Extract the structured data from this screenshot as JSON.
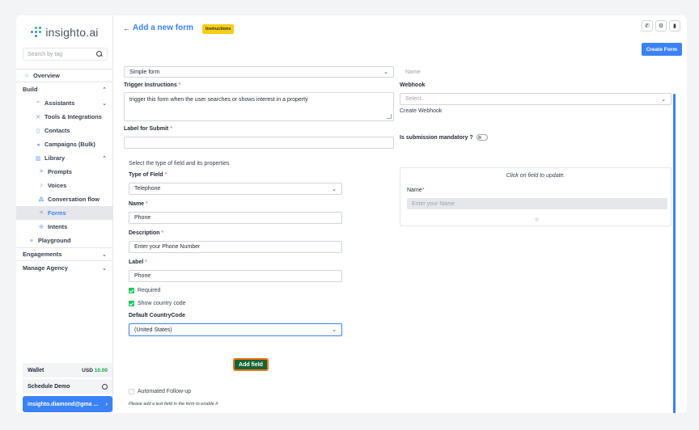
{
  "app": {
    "logo_text": "insighto.ai"
  },
  "sidebar": {
    "search_placeholder": "Search by tag",
    "items": [
      {
        "label": "Overview",
        "icon": "home-icon"
      },
      {
        "label": "Build",
        "icon": ""
      },
      {
        "label": "Assistants",
        "icon": "assistant-icon"
      },
      {
        "label": "Tools & Integrations",
        "icon": "tools-icon"
      },
      {
        "label": "Contacts",
        "icon": "contacts-icon"
      },
      {
        "label": "Campaigns (Bulk)",
        "icon": "megaphone-icon"
      },
      {
        "label": "Library",
        "icon": "library-icon"
      },
      {
        "label": "Prompts",
        "icon": "prompt-icon"
      },
      {
        "label": "Voices",
        "icon": "voice-icon"
      },
      {
        "label": "Conversation flow",
        "icon": "flow-icon"
      },
      {
        "label": "Forms",
        "icon": "forms-icon"
      },
      {
        "label": "Intents",
        "icon": "intents-icon"
      },
      {
        "label": "Playground",
        "icon": "playground-icon"
      },
      {
        "label": "Engagements",
        "icon": ""
      },
      {
        "label": "Manage Agency",
        "icon": ""
      }
    ],
    "wallet_label": "Wallet",
    "wallet_currency": "USD",
    "wallet_amount": "10.00",
    "schedule_label": "Schedule Demo",
    "user_label": "insighto.diamond@gma ..."
  },
  "header": {
    "back": "←",
    "title": "Add a new form",
    "instructions_badge": "Instructions",
    "create_button": "Create Form"
  },
  "form": {
    "form_type_value": "Simple form",
    "name_placeholder": "Name",
    "trigger_label": "Trigger Instructions",
    "trigger_value": "trigger this form when the user searches or shows interest in a property",
    "webhook_label": "Webhook",
    "webhook_placeholder": "Select..",
    "create_webhook": "Create Webhook",
    "submit_label_label": "Label for Submit",
    "submit_label_value": "",
    "mandatory_label": "Is submission mandatory ?",
    "field_section_title": "Select the type of field and its properties",
    "type_label": "Type of Field",
    "type_value": "Telephone",
    "name_label": "Name",
    "name_value": "Phone",
    "description_label": "Description",
    "description_value": "Enter your Phone Number",
    "label_label": "Label",
    "label_value": "Phone",
    "required_label": "Required",
    "show_code_label": "Show country code",
    "country_code_label": "Default CountryCode",
    "country_code_value": "(United States)",
    "add_field_button": "Add field",
    "followup_label": "Automated Follow-up",
    "followup_hint": "Please add a text field in the form to enable it"
  },
  "preview": {
    "hint": "Click on field to update.",
    "field_name": "Name",
    "field_placeholder": "Enter your Name"
  }
}
